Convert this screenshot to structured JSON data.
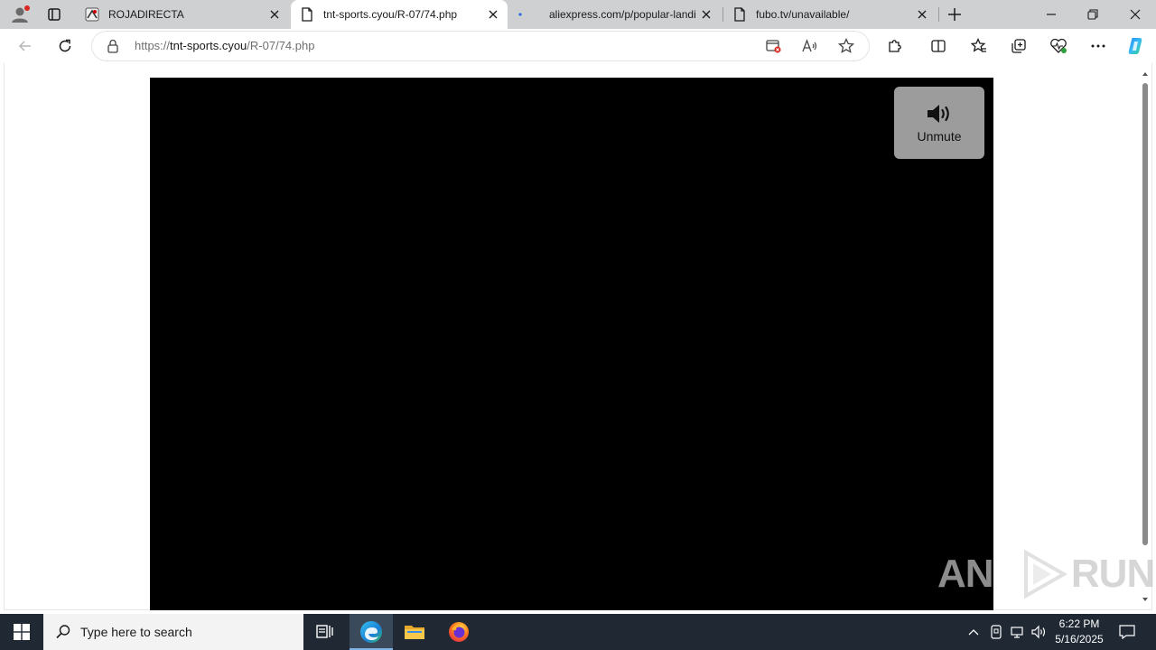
{
  "browser": {
    "tabs": [
      {
        "title": "ROJADIRECTA",
        "favicon": "rojadirecta-favicon"
      },
      {
        "title": "tnt-sports.cyou/R-07/74.php",
        "favicon": "page-icon"
      },
      {
        "title": "aliexpress.com/p/popular-landing",
        "favicon": "loading-dot"
      },
      {
        "title": "fubo.tv/unavailable/",
        "favicon": "page-icon"
      }
    ],
    "active_tab": 1,
    "address": {
      "scheme": "https://",
      "host": "tnt-sports.cyou",
      "path": "/R-07/74.php"
    }
  },
  "player": {
    "unmute_label": "Unmute"
  },
  "watermark": {
    "left": "ANY",
    "right": "RUN"
  },
  "taskbar": {
    "search_placeholder": "Type here to search",
    "time": "6:22 PM",
    "date": "5/16/2025"
  },
  "colors": {
    "tabstrip": "#cfd0d2",
    "taskbar": "#1f2833",
    "player": "#000000",
    "unmute_bg": "#9c9c9c"
  }
}
